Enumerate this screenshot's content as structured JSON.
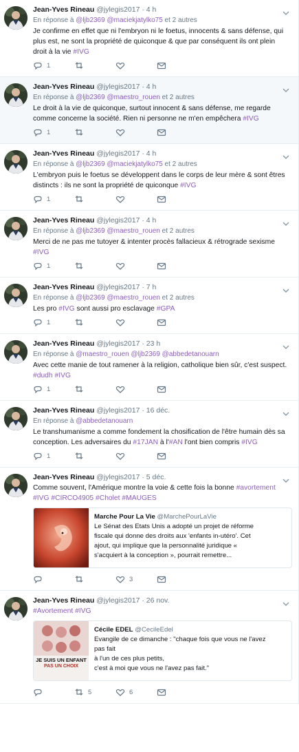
{
  "tweets": [
    {
      "name": "Jean-Yves Rineau",
      "handle": "@jylegis2017",
      "time": "4 h",
      "reply_prefix": "En réponse à",
      "reply_links": [
        "@ljb2369",
        "@maciekjatylko75"
      ],
      "reply_suffix": "et 2 autres",
      "lines": [
        [
          {
            "t": "Je confirme en effet que ni l'embryon ni le foetus, innocents & sans défense, qui"
          }
        ],
        [
          {
            "t": "plus est, ne sont la propriété de quiconque & que par conséquent ils ont plein"
          }
        ],
        [
          {
            "t": "droit à la vie "
          },
          {
            "t": "#IVG",
            "tag": true
          }
        ]
      ],
      "replies": "1",
      "retweets": "",
      "likes": "",
      "selected": false
    },
    {
      "name": "Jean-Yves Rineau",
      "handle": "@jylegis2017",
      "time": "4 h",
      "reply_prefix": "En réponse à",
      "reply_links": [
        "@ljb2369",
        "@maestro_rouen"
      ],
      "reply_suffix": "et 2 autres",
      "lines": [
        [
          {
            "t": "Le droit à la vie de quiconque, surtout innocent & sans défense, me regarde"
          }
        ],
        [
          {
            "t": "comme concerne la société. Rien ni personne ne m'en empêchera "
          },
          {
            "t": "#IVG",
            "tag": true
          }
        ]
      ],
      "replies": "1",
      "retweets": "",
      "likes": "",
      "selected": true
    },
    {
      "name": "Jean-Yves Rineau",
      "handle": "@jylegis2017",
      "time": "4 h",
      "reply_prefix": "En réponse à",
      "reply_links": [
        "@ljb2369",
        "@maciekjatylko75"
      ],
      "reply_suffix": "et 2 autres",
      "lines": [
        [
          {
            "t": "L'embryon puis le foetus se développent dans le corps de leur mère & sont êtres"
          }
        ],
        [
          {
            "t": "distincts : ils ne sont la propriété de quiconque "
          },
          {
            "t": "#IVG",
            "tag": true
          }
        ]
      ],
      "replies": "1",
      "retweets": "",
      "likes": "",
      "selected": false
    },
    {
      "name": "Jean-Yves Rineau",
      "handle": "@jylegis2017",
      "time": "4 h",
      "reply_prefix": "En réponse à",
      "reply_links": [
        "@ljb2369",
        "@maestro_rouen"
      ],
      "reply_suffix": "et 2 autres",
      "lines": [
        [
          {
            "t": "Merci de ne pas me tutoyer & intenter procès fallacieux & rétrograde sexisme"
          }
        ],
        [
          {
            "t": "#IVG",
            "tag": true
          }
        ]
      ],
      "replies": "1",
      "retweets": "",
      "likes": "",
      "selected": false
    },
    {
      "name": "Jean-Yves Rineau",
      "handle": "@jylegis2017",
      "time": "7 h",
      "reply_prefix": "En réponse à",
      "reply_links": [
        "@ljb2369",
        "@maestro_rouen"
      ],
      "reply_suffix": "et 2 autres",
      "lines": [
        [
          {
            "t": "Les pro "
          },
          {
            "t": "#IVG",
            "tag": true
          },
          {
            "t": " sont aussi pro esclavage  "
          },
          {
            "t": "#GPA",
            "tag": true
          }
        ]
      ],
      "replies": "1",
      "retweets": "",
      "likes": "",
      "selected": false
    },
    {
      "name": "Jean-Yves Rineau",
      "handle": "@jylegis2017",
      "time": "23 h",
      "reply_prefix": "En réponse à",
      "reply_links": [
        "@maestro_rouen",
        "@ljb2369",
        "@abbedetanouarn"
      ],
      "reply_suffix": "",
      "lines": [
        [
          {
            "t": "Avec cette manie de tout ramener à la religion, catholique bien sûr, c'est suspect."
          }
        ],
        [
          {
            "t": "#dudh",
            "tag": true
          },
          {
            "t": " "
          },
          {
            "t": "#IVG",
            "tag": true
          }
        ]
      ],
      "replies": "1",
      "retweets": "",
      "likes": "",
      "selected": false
    },
    {
      "name": "Jean-Yves Rineau",
      "handle": "@jylegis2017",
      "time": "16 déc.",
      "reply_prefix": "En réponse à",
      "reply_links": [
        "@abbedetanouarn"
      ],
      "reply_suffix": "",
      "lines": [
        [
          {
            "t": "Le transhumanisme a comme fondement la chosification de l'être humain dès sa"
          }
        ],
        [
          {
            "t": "conception. Les adversaires du "
          },
          {
            "t": "#17JAN",
            "tag": true
          },
          {
            "t": " à l'"
          },
          {
            "t": "#AN",
            "tag": true
          },
          {
            "t": " l'ont bien compris "
          },
          {
            "t": "#IVG",
            "tag": true
          }
        ]
      ],
      "replies": "1",
      "retweets": "",
      "likes": "",
      "selected": false
    },
    {
      "name": "Jean-Yves Rineau",
      "handle": "@jylegis2017",
      "time": "5 déc.",
      "reply_prefix": "",
      "reply_links": [],
      "reply_suffix": "",
      "lines": [
        [
          {
            "t": "Comme souvent, l'Amérique montre la voie & cette fois la bonne "
          },
          {
            "t": "#avortement",
            "tag": true
          }
        ],
        [
          {
            "t": "#IVG",
            "tag": true
          },
          {
            "t": " "
          },
          {
            "t": "#CIRCO4905",
            "tag": true
          },
          {
            "t": " "
          },
          {
            "t": "#Cholet",
            "tag": true
          },
          {
            "t": " "
          },
          {
            "t": "#MAUGES",
            "tag": true
          }
        ]
      ],
      "card": {
        "name": "Marche Pour La Vie",
        "handle": "@MarchePourLaVie",
        "thumb": "embryo",
        "lines": [
          "Le Sénat des Etats Unis a adopté un projet de réforme",
          "fiscale qui donne des droits aux 'enfants in-utéro'. Cet",
          "ajout, qui implique que la personnalité juridique «",
          "s'acquiert à la conception », pourrait remettre..."
        ]
      },
      "replies": "",
      "retweets": "",
      "likes": "3",
      "selected": false
    },
    {
      "name": "Jean-Yves Rineau",
      "handle": "@jylegis2017",
      "time": "26 nov.",
      "reply_prefix": "",
      "reply_links": [],
      "reply_suffix": "",
      "lines": [
        [
          {
            "t": "#Avortement",
            "tag": true
          },
          {
            "t": " "
          },
          {
            "t": "#IVG",
            "tag": true
          }
        ]
      ],
      "card": {
        "name": "Cécile EDEL",
        "handle": "@CecileEdel",
        "thumb": "poster",
        "poster_line1": "JE SUIS UN ENFANT",
        "poster_line2": "PAS UN CHOIX",
        "lines": [
          "Evangile de ce dimanche : \"chaque fois que vous ne l'avez",
          "pas fait",
          "à l'un de ces plus petits,",
          "c'est à moi que vous ne l'avez pas fait.\""
        ]
      },
      "replies": "",
      "retweets": "5",
      "likes": "6",
      "selected": false
    }
  ]
}
